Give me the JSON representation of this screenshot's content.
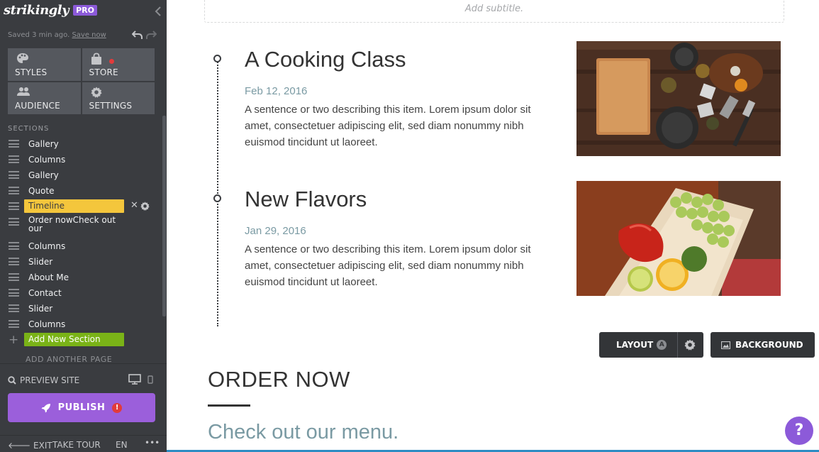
{
  "sidebar": {
    "logo": "strikingly",
    "plan_badge": "PRO",
    "saved_text": "Saved 3 min ago.",
    "save_now": "Save now",
    "tiles": {
      "styles": "STYLES",
      "store": "STORE",
      "audience": "AUDIENCE",
      "settings": "SETTINGS"
    },
    "sections_heading": "SECTIONS",
    "sections": [
      "Gallery",
      "Columns",
      "Gallery",
      "Quote",
      "Timeline",
      "Order nowCheck out our",
      "Columns",
      "Slider",
      "About Me",
      "Contact",
      "Slider",
      "Columns"
    ],
    "add_section": "Add New Section",
    "add_page": "ADD ANOTHER PAGE",
    "preview_site": "PREVIEW SITE",
    "publish": "PUBLISH",
    "publish_alert": "!",
    "footer": {
      "exit": "EXIT",
      "tour": "TAKE TOUR",
      "lang": "EN",
      "more": "•••"
    }
  },
  "canvas": {
    "subtitle_placeholder": "Add subtitle.",
    "timeline": [
      {
        "title": "A Cooking Class",
        "date": "Feb 12, 2016",
        "description": "A sentence or two describing this item. Lorem ipsum dolor sit amet, consectetuer adipiscing elit, sed diam nonummy nibh euismod tincidunt ut laoreet."
      },
      {
        "title": "New Flavors",
        "date": "Jan 29, 2016",
        "description": "A sentence or two describing this item. Lorem ipsum dolor sit amet, consectetuer adipiscing elit, sed diam nonummy nibh euismod tincidunt ut laoreet."
      }
    ],
    "layout_button": "LAYOUT",
    "layout_variant": "A",
    "background_button": "BACKGROUND",
    "order_title": "ORDER NOW",
    "order_subtitle": "Check out our menu.",
    "help": "?"
  },
  "colors": {
    "sidebar_bg": "#3a3c40",
    "accent_purple": "#9b5fdb",
    "active_section": "#f4c63c",
    "add_section": "#7ab317",
    "date_teal": "#7a9aa3"
  }
}
